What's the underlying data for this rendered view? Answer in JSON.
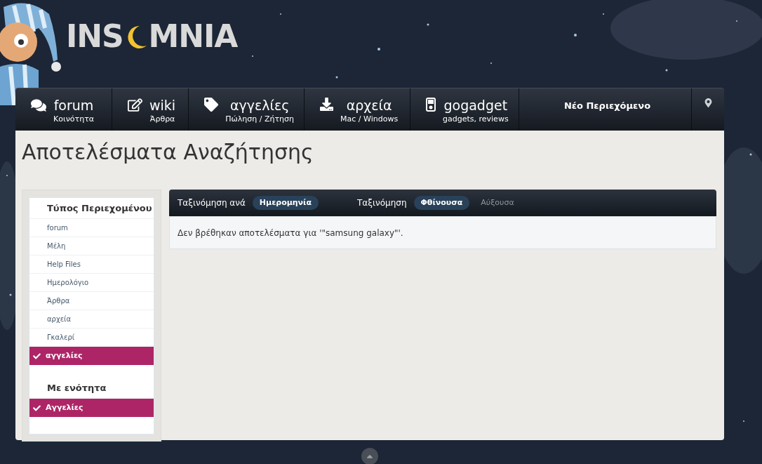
{
  "logo": {
    "before_moon": "INS",
    "after_moon": "MNIA"
  },
  "nav": [
    {
      "kind": "chat",
      "label": "forum",
      "sub": "Κοινότητα"
    },
    {
      "kind": "edit",
      "label": "wiki",
      "sub": "Άρθρα"
    },
    {
      "kind": "tag",
      "label": "αγγελίες",
      "sub": "Πώληση / Ζήτηση"
    },
    {
      "kind": "download",
      "label": "αρχεία",
      "sub": "Mac / Windows"
    },
    {
      "kind": "player",
      "label": "gogadget",
      "sub": "gadgets, reviews"
    }
  ],
  "new_content": "Νέο Περιεχόμενο",
  "page_title": "Αποτελέσματα Αναζήτησης",
  "sidebar": {
    "sections": [
      {
        "title": "Τύπος Περιεχομένου",
        "items": [
          {
            "label": "forum",
            "selected": false
          },
          {
            "label": "Μέλη",
            "selected": false
          },
          {
            "label": "Help Files",
            "selected": false
          },
          {
            "label": "Ημερολόγιο",
            "selected": false
          },
          {
            "label": "Άρθρα",
            "selected": false
          },
          {
            "label": "αρχεία",
            "selected": false
          },
          {
            "label": "Γκαλερί",
            "selected": false
          },
          {
            "label": "αγγελίες",
            "selected": true
          }
        ]
      },
      {
        "title": "Με ενότητα",
        "items": [
          {
            "label": "Αγγελίες",
            "selected": true
          }
        ]
      }
    ]
  },
  "sort_bar": {
    "groups": [
      {
        "label": "Ταξινόμηση ανά",
        "options": [
          {
            "label": "Ημερομηνία",
            "selected": true
          }
        ]
      },
      {
        "label": "Ταξινόμηση",
        "options": [
          {
            "label": "Φθίνουσα",
            "selected": true
          },
          {
            "label": "Αύξουσα",
            "selected": false
          }
        ]
      }
    ]
  },
  "message": "Δεν βρέθηκαν αποτελέσματα για '\"samsung galaxy\"'."
}
